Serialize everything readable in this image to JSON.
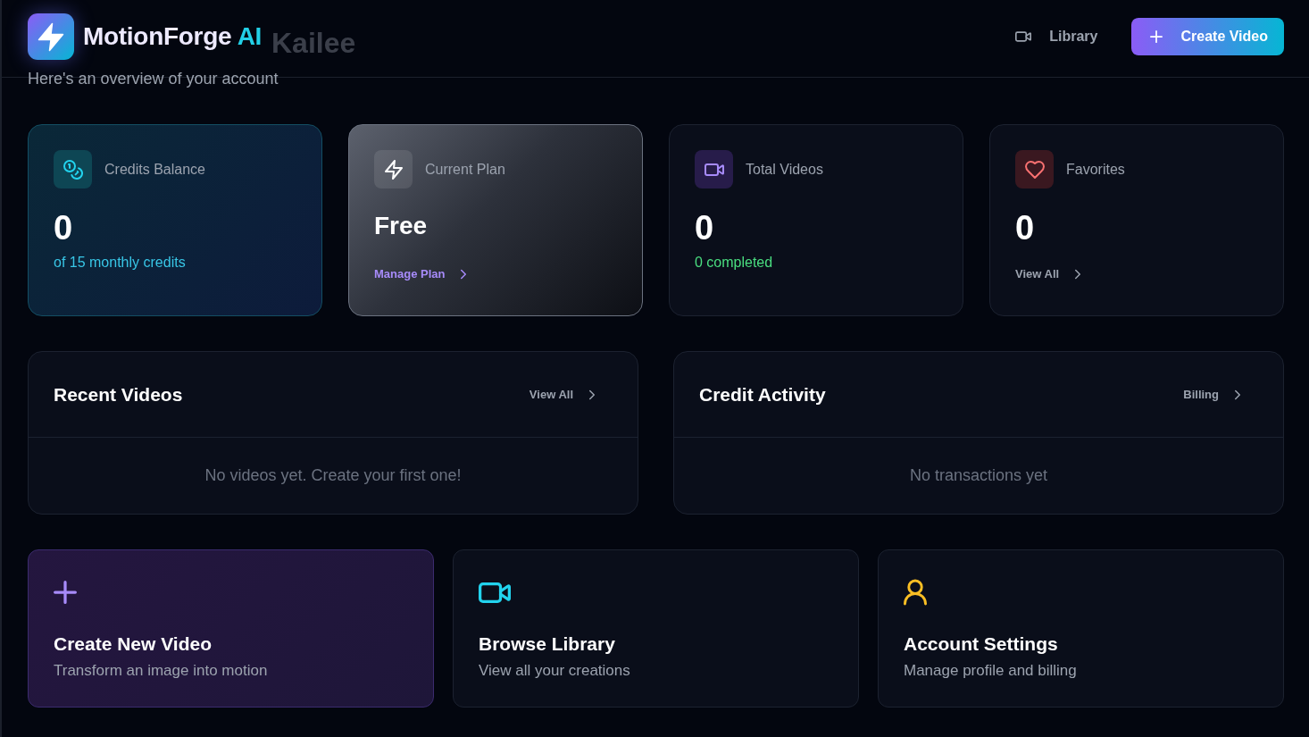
{
  "header": {
    "logo": {
      "name": "MotionForge",
      "suffix": "AI"
    },
    "library_link": {
      "label": "Library"
    },
    "create_button": {
      "label": "Create Video"
    }
  },
  "greeting": {
    "title": "Kailee",
    "subtitle": "Here's an overview of your account"
  },
  "stats": [
    {
      "kind": "credits",
      "label": "Credits Balance",
      "value": "0",
      "note": "of 15 monthly credits"
    },
    {
      "kind": "plan",
      "label": "Current Plan",
      "value": "Free",
      "link": "Manage Plan"
    },
    {
      "kind": "videos",
      "label": "Total Videos",
      "value": "0",
      "note": "0 completed"
    },
    {
      "kind": "favorites",
      "label": "Favorites",
      "value": "0",
      "link": "View All"
    }
  ],
  "panels": [
    {
      "title": "Recent Videos",
      "link": "View All",
      "empty": "No videos yet. Create your first one!"
    },
    {
      "title": "Credit Activity",
      "link": "Billing",
      "empty": "No transactions yet"
    }
  ],
  "actions": [
    {
      "kind": "create",
      "title": "Create New Video",
      "description": "Transform an image into motion"
    },
    {
      "kind": "library",
      "title": "Browse Library",
      "description": "View all your creations"
    },
    {
      "kind": "account",
      "title": "Account Settings",
      "description": "Manage profile and billing"
    }
  ]
}
